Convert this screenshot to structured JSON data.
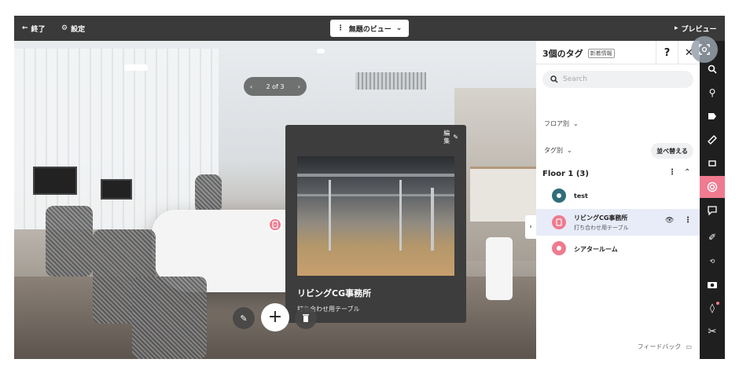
{
  "topbar": {
    "exit_label": "終了",
    "settings_label": "設定",
    "view_name": "無題のビュー",
    "preview_label": "プレビュー"
  },
  "scene": {
    "nav_counter": "2 of 3"
  },
  "popup": {
    "edit_label": "編集",
    "title": "リビングCG事務所",
    "subtitle": "打ち合わせ用テーブル"
  },
  "panel": {
    "title": "3個のタグ",
    "badge": "新着情報",
    "help_label": "?",
    "close_label": "✕",
    "search_placeholder": "Search",
    "filter_floor": "フロア別",
    "filter_tag": "タグ別",
    "sort_label": "並べ替える",
    "floor_heading": "Floor 1 (3)",
    "feedback_label": "フィードバック",
    "items": [
      {
        "label": "test",
        "sub": "",
        "color": "#2f6d78"
      },
      {
        "label": "リビングCG事務所",
        "sub": "打ち合わせ用テーブル",
        "color": "#f07a8f"
      },
      {
        "label": "シアタールーム",
        "sub": "",
        "color": "#f07a8f"
      }
    ]
  },
  "colors": {
    "accent": "#f07a8f",
    "teal": "#2f6d78",
    "selected_row": "#e8ecf9"
  }
}
